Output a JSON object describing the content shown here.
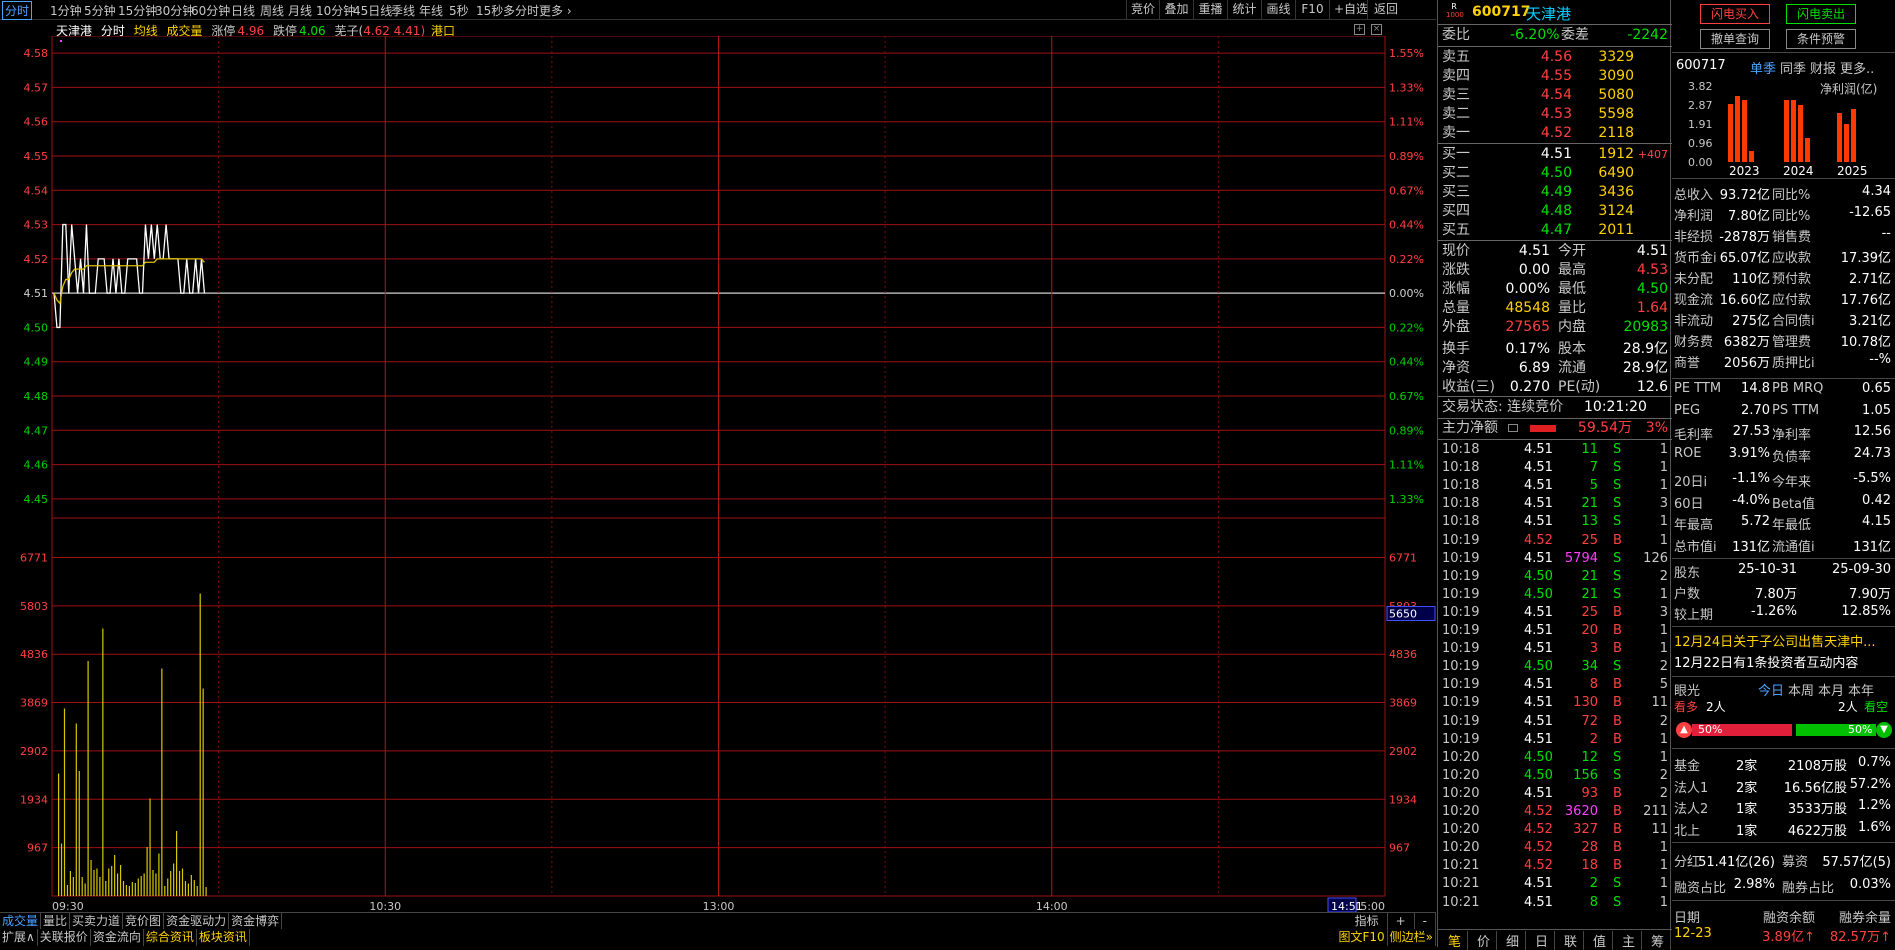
{
  "periods": [
    "分时",
    "1分钟",
    "5分钟",
    "15分钟",
    "30分钟",
    "60分钟",
    "日线",
    "周线",
    "月线",
    "10分钟",
    "45日线",
    "季线",
    "年线",
    "5秒",
    "15秒",
    "多分时",
    "更多"
  ],
  "toolbar_right": [
    "竞价",
    "叠加",
    "重播",
    "统计",
    "画线",
    "F10",
    "+自选",
    "返回"
  ],
  "info": {
    "name": "天津港",
    "mode": "分时",
    "avg_label": "均线",
    "vol_label": "成交量",
    "limit_up_label": "涨停",
    "limit_up": "4.96",
    "limit_down_label": "跌停",
    "limit_down": "4.06",
    "ref_label": "芜子(",
    "ref_values": "4.62 4.41)",
    "ref_tail": "港口"
  },
  "price_axis": {
    "left": [
      "4.58",
      "4.57",
      "4.56",
      "4.55",
      "4.54",
      "4.53",
      "4.52",
      "4.51",
      "4.50",
      "4.49",
      "4.48",
      "4.47",
      "4.46",
      "4.45"
    ],
    "right": [
      "1.55%",
      "1.33%",
      "1.11%",
      "0.89%",
      "0.67%",
      "0.44%",
      "0.22%",
      "0.00%",
      "0.22%",
      "0.44%",
      "0.67%",
      "0.89%",
      "1.11%",
      "1.33%"
    ]
  },
  "vol_axis": [
    "6771",
    "5803",
    "4836",
    "3869",
    "2902",
    "1934",
    "967"
  ],
  "vol_marker": "5650",
  "time_axis": [
    "09:30",
    "10:30",
    "13:00",
    "14:00",
    "15:00"
  ],
  "time_marker": "14:51",
  "chart_data": {
    "type": "line",
    "x_range": [
      "09:30",
      "15:00"
    ],
    "prev_close": 4.51,
    "ylim": [
      4.445,
      4.585
    ],
    "series": [
      {
        "values": [
          4.51,
          4.5,
          4.5,
          4.53,
          4.53,
          4.51,
          4.53,
          4.52,
          4.51,
          4.52,
          4.51,
          4.53,
          4.51,
          4.51,
          4.51,
          4.52,
          4.52,
          4.52,
          4.51,
          4.51,
          4.52,
          4.51,
          4.52,
          4.51,
          4.51,
          4.52,
          4.52,
          4.52,
          4.52,
          4.51,
          4.51,
          4.53,
          4.52,
          4.53,
          4.52,
          4.53,
          4.52,
          4.52,
          4.53,
          4.52,
          4.52,
          4.52,
          4.52,
          4.51,
          4.51,
          4.52,
          4.51,
          4.51,
          4.52,
          4.51,
          4.52,
          4.51
        ]
      },
      {
        "values": [
          4.51,
          4.508,
          4.507,
          4.512,
          4.514,
          4.514,
          4.516,
          4.517,
          4.517,
          4.517,
          4.517,
          4.518,
          4.518,
          4.518,
          4.518,
          4.518,
          4.518,
          4.518,
          4.518,
          4.518,
          4.518,
          4.518,
          4.518,
          4.518,
          4.518,
          4.518,
          4.518,
          4.518,
          4.518,
          4.518,
          4.518,
          4.519,
          4.519,
          4.519,
          4.519,
          4.52,
          4.52,
          4.52,
          4.52,
          4.52,
          4.52,
          4.52,
          4.52,
          4.52,
          4.52,
          4.52,
          4.52,
          4.52,
          4.52,
          4.52,
          4.52,
          4.519
        ]
      }
    ],
    "volume": [
      2450,
      1050,
      3750,
      220,
      500,
      380,
      3450,
      2500,
      380,
      250,
      4700,
      720,
      520,
      550,
      380,
      5350,
      300,
      550,
      600,
      820,
      450,
      620,
      300,
      220,
      200,
      280,
      260,
      350,
      400,
      450,
      980,
      1950,
      520,
      450,
      850,
      4550,
      200,
      350,
      500,
      650,
      1300,
      500,
      550,
      300,
      250,
      420,
      320,
      200,
      6050,
      4150,
      180
    ]
  },
  "order_book": {
    "ratio_label": "委比",
    "ratio": "-6.20%",
    "diff_label": "委差",
    "diff": "-2242",
    "asks": [
      {
        "l": "卖五",
        "p": "4.56",
        "v": "3329"
      },
      {
        "l": "卖四",
        "p": "4.55",
        "v": "3090"
      },
      {
        "l": "卖三",
        "p": "4.54",
        "v": "5080"
      },
      {
        "l": "卖二",
        "p": "4.53",
        "v": "5598"
      },
      {
        "l": "卖一",
        "p": "4.52",
        "v": "2118"
      }
    ],
    "bids": [
      {
        "l": "买一",
        "p": "4.51",
        "v": "1912",
        "x": "+407"
      },
      {
        "l": "买二",
        "p": "4.50",
        "v": "6490",
        "x": ""
      },
      {
        "l": "买三",
        "p": "4.49",
        "v": "3436",
        "x": ""
      },
      {
        "l": "买四",
        "p": "4.48",
        "v": "3124",
        "x": ""
      },
      {
        "l": "买五",
        "p": "4.47",
        "v": "2011",
        "x": ""
      }
    ]
  },
  "header": {
    "code": "600717",
    "name": "天津港",
    "badge_top": "R",
    "badge_bot": "1000"
  },
  "quote": [
    [
      "现价",
      "4.51",
      "今开",
      "4.51"
    ],
    [
      "涨跌",
      "0.00",
      "最高",
      "4.53"
    ],
    [
      "涨幅",
      "0.00%",
      "最低",
      "4.50"
    ],
    [
      "总量",
      "48548",
      "量比",
      "1.64"
    ],
    [
      "外盘",
      "27565",
      "内盘",
      "20983"
    ],
    [
      "换手",
      "0.17%",
      "股本",
      "28.9亿"
    ],
    [
      "净资",
      "6.89",
      "流通",
      "28.9亿"
    ],
    [
      "收益(三)",
      "0.270",
      "PE(动)",
      "12.6"
    ]
  ],
  "trade_state": "交易状态: 连续竞价",
  "trade_time": "10:21:20",
  "main_net": {
    "label": "主力净额",
    "value": "59.54万",
    "pct": "3%"
  },
  "ticks": [
    [
      "10:18",
      "4.51",
      "11",
      "S",
      "1"
    ],
    [
      "10:18",
      "4.51",
      "7",
      "S",
      "1"
    ],
    [
      "10:18",
      "4.51",
      "5",
      "S",
      "1"
    ],
    [
      "10:18",
      "4.51",
      "21",
      "S",
      "3"
    ],
    [
      "10:18",
      "4.51",
      "13",
      "S",
      "1"
    ],
    [
      "10:19",
      "4.52",
      "25",
      "B",
      "1"
    ],
    [
      "10:19",
      "4.51",
      "5794",
      "S",
      "126"
    ],
    [
      "10:19",
      "4.50",
      "21",
      "S",
      "2"
    ],
    [
      "10:19",
      "4.50",
      "21",
      "S",
      "1"
    ],
    [
      "10:19",
      "4.51",
      "25",
      "B",
      "3"
    ],
    [
      "10:19",
      "4.51",
      "20",
      "B",
      "1"
    ],
    [
      "10:19",
      "4.51",
      "3",
      "B",
      "1"
    ],
    [
      "10:19",
      "4.50",
      "34",
      "S",
      "2"
    ],
    [
      "10:19",
      "4.51",
      "8",
      "B",
      "5"
    ],
    [
      "10:19",
      "4.51",
      "130",
      "B",
      "11"
    ],
    [
      "10:19",
      "4.51",
      "72",
      "B",
      "2"
    ],
    [
      "10:19",
      "4.51",
      "2",
      "B",
      "1"
    ],
    [
      "10:20",
      "4.50",
      "12",
      "S",
      "1"
    ],
    [
      "10:20",
      "4.50",
      "156",
      "S",
      "2"
    ],
    [
      "10:20",
      "4.51",
      "93",
      "B",
      "2"
    ],
    [
      "10:20",
      "4.52",
      "3620",
      "B",
      "211"
    ],
    [
      "10:20",
      "4.52",
      "327",
      "B",
      "11"
    ],
    [
      "10:20",
      "4.52",
      "28",
      "B",
      "1"
    ],
    [
      "10:21",
      "4.52",
      "18",
      "B",
      "1"
    ],
    [
      "10:21",
      "4.51",
      "2",
      "S",
      "1"
    ],
    [
      "10:21",
      "4.51",
      "8",
      "S",
      "1"
    ]
  ],
  "mid_bottom": [
    "笔",
    "价",
    "细",
    "日",
    "联",
    "值",
    "主",
    "筹"
  ],
  "bottom1": [
    "成交量",
    "量比",
    "买卖力道",
    "竞价图",
    "资金驱动力",
    "资金博弈"
  ],
  "bottom2": [
    "扩展∧",
    "关联报价",
    "资金流向",
    "综合资讯",
    "板块资讯"
  ],
  "bottom_right1": [
    "指标",
    "+",
    "-"
  ],
  "bottom_right2": [
    "图文F10",
    "侧边栏»"
  ],
  "right": {
    "buttons": [
      "闪电买入",
      "闪电卖出",
      "撤单查询",
      "条件预警"
    ],
    "fin_tabs": [
      "600717",
      "单季",
      "同季",
      "财报",
      "更多.."
    ],
    "fin_label": "净利润(亿)",
    "fin_axis": [
      "3.82",
      "2.87",
      "1.91",
      "0.96",
      "0.00"
    ],
    "fin_years": [
      "2023",
      "2024",
      "2025"
    ],
    "fin_bars": [
      3.1,
      3.5,
      3.3,
      0.6,
      3.3,
      3.3,
      3.0,
      1.3,
      2.6,
      2.0,
      2.8
    ],
    "kv": [
      [
        "总收入",
        "93.72亿",
        "同比%",
        "4.34"
      ],
      [
        "净利润",
        "7.80亿",
        "同比%",
        "-12.65"
      ],
      [
        "非经损",
        "-2878万",
        "销售费",
        "--"
      ],
      [
        "货币金i",
        "65.07亿",
        "应收款",
        "17.39亿"
      ],
      [
        "未分配",
        "110亿",
        "预付款",
        "2.71亿"
      ],
      [
        "现金流",
        "16.60亿",
        "应付款",
        "17.76亿"
      ],
      [
        "非流动",
        "275亿",
        "合同债i",
        "3.21亿"
      ],
      [
        "财务费",
        "6382万",
        "管理费",
        "10.78亿"
      ],
      [
        "商誉",
        "2056万",
        "质押比i",
        "--%"
      ]
    ],
    "val": [
      [
        "PE TTM",
        "14.8",
        "PB MRQ",
        "0.65"
      ],
      [
        "PEG",
        "2.70",
        "PS TTM",
        "1.05"
      ],
      [
        "毛利率",
        "27.53",
        "净利率",
        "12.56"
      ],
      [
        "ROE",
        "3.91%",
        "负债率",
        "24.73"
      ]
    ],
    "perf": [
      [
        "20日i",
        "-1.1%",
        "今年来",
        "-5.5%"
      ],
      [
        "60日",
        "-4.0%",
        "Beta值",
        "0.42"
      ],
      [
        "年最高",
        "5.72",
        "年最低",
        "4.15"
      ],
      [
        "总市值i",
        "131亿",
        "流通值i",
        "131亿"
      ]
    ],
    "holders": {
      "h": [
        "股东",
        "25-10-31",
        "25-09-30"
      ],
      "r1": [
        "户数",
        "7.80万",
        "7.90万"
      ],
      "r2": [
        "较上期",
        "-1.26%",
        "12.85%"
      ]
    },
    "news1": "12月24日关于子公司出售天津中...",
    "news2": "12月22日有1条投资者互动内容",
    "eye": {
      "label": "眼光",
      "tabs": [
        "今日",
        "本周",
        "本月",
        "本年"
      ],
      "bull": "看多",
      "bull_n": "2人",
      "bear_n": "2人",
      "bear": "看空",
      "bull_pct": "50%",
      "bear_pct": "50%"
    },
    "inst": [
      [
        "基金",
        "2家",
        "2108万股",
        "0.7%"
      ],
      [
        "法人1",
        "2家",
        "16.56亿股",
        "57.2%"
      ],
      [
        "法人2",
        "1家",
        "3533万股",
        "1.2%"
      ],
      [
        "北上",
        "1家",
        "4622万股",
        "1.6%"
      ]
    ],
    "div": [
      "分红",
      "51.41亿(26)",
      "募资",
      "57.57亿(5)"
    ],
    "margin": [
      "融资占比",
      "2.98%",
      "融券占比",
      "0.03%"
    ],
    "mf_head": [
      "日期",
      "融资余额",
      "融券余量"
    ],
    "mf_row": [
      "12-23",
      "3.89亿↑",
      "82.57万↑"
    ]
  }
}
